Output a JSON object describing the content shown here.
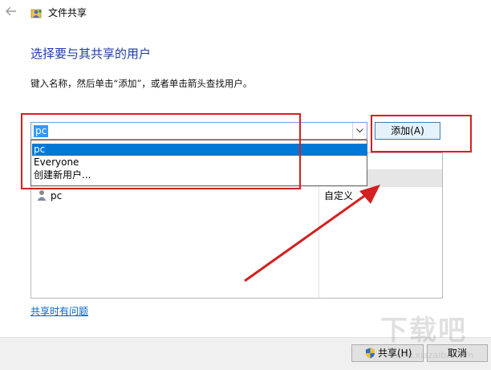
{
  "window": {
    "title": "文件共享"
  },
  "main": {
    "heading": "选择要与其共享的用户",
    "instruction": "键入名称，然后单击“添加”，或者单击箭头查找用户。"
  },
  "name_input": {
    "value": "pc"
  },
  "dropdown": {
    "options": [
      "pc",
      "Everyone",
      "创建新用户..."
    ],
    "selected": "pc"
  },
  "add_button": {
    "label": "添加(A)"
  },
  "users": [
    {
      "name": "pc",
      "permission": "自定义"
    }
  ],
  "help_link": {
    "label": "共享时有问题"
  },
  "footer": {
    "share_label": "共享(H)",
    "cancel_label": "取消"
  },
  "watermark": {
    "text": "下载吧",
    "url": "www.xiazaiba.com"
  },
  "colors": {
    "heading": "#1f3ba7",
    "selection": "#0078d7",
    "annotation": "#d42020",
    "link": "#0066cc"
  },
  "icons": [
    "back-arrow-icon",
    "share-app-icon",
    "dropdown-arrow-icon",
    "user-icon",
    "uac-shield-icon"
  ]
}
